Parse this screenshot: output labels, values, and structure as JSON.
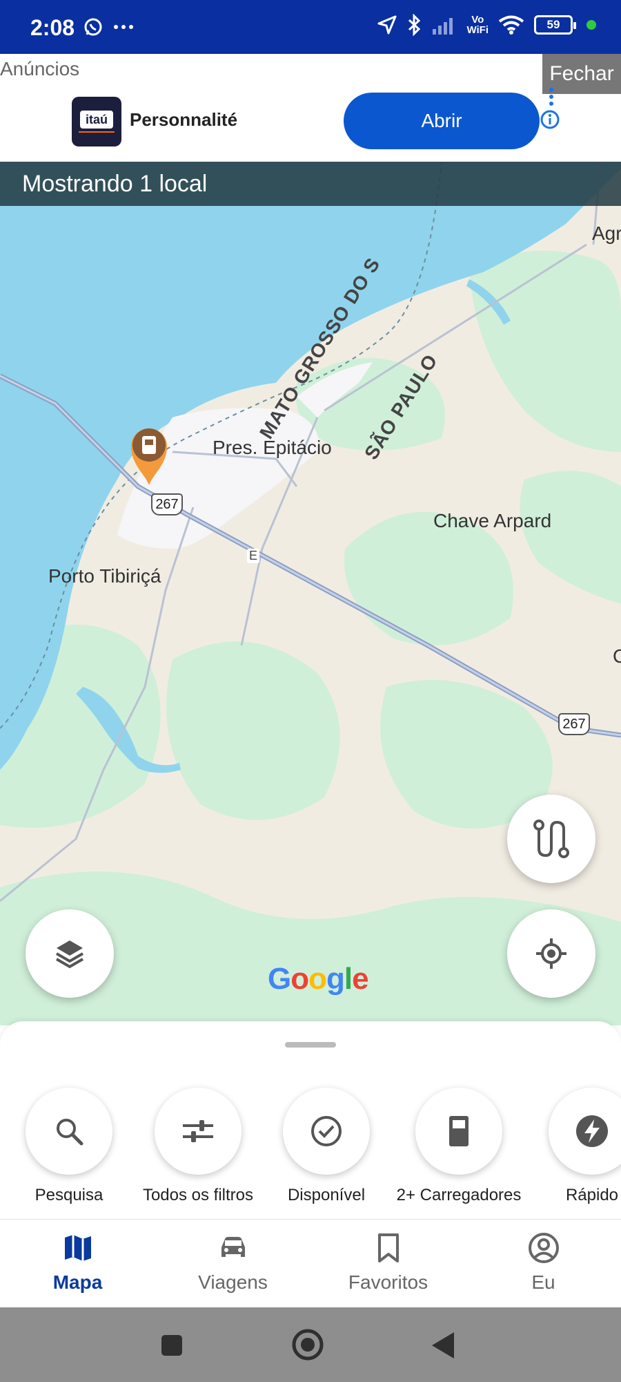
{
  "status_bar": {
    "time": "2:08",
    "vowifi_top": "Vo",
    "vowifi_bottom": "WiFi",
    "battery": "59"
  },
  "ad": {
    "label": "Anúncios",
    "close": "Fechar",
    "logo_text": "itaú",
    "brand": "Personnalité",
    "cta": "Abrir"
  },
  "map": {
    "showing": "Mostrando 1 local",
    "labels": {
      "mato_grosso": "MATO GROSSO DO S",
      "sao_paulo": "SÃO PAULO",
      "agr": "Agr",
      "pres_epitacio": "Pres. Epitácio",
      "chave_arpard": "Chave Arpard",
      "porto_tibirica": "Porto Tibiriçá",
      "edge_c": "C"
    },
    "road_shields": [
      "267",
      "267"
    ],
    "road_e": "E",
    "google": [
      "G",
      "o",
      "o",
      "g",
      "l",
      "e"
    ]
  },
  "filters": [
    {
      "label": "Pesquisa",
      "icon": "search-icon"
    },
    {
      "label": "Todos os filtros",
      "icon": "sliders-icon"
    },
    {
      "label": "Disponível",
      "icon": "check-circle-icon"
    },
    {
      "label": "2+ Carregadores",
      "icon": "fuel-pump-icon"
    },
    {
      "label": "Rápido",
      "icon": "bolt-icon"
    }
  ],
  "nav": [
    {
      "label": "Mapa",
      "icon": "map-icon",
      "active": true
    },
    {
      "label": "Viagens",
      "icon": "car-icon",
      "active": false
    },
    {
      "label": "Favoritos",
      "icon": "bookmark-icon",
      "active": false
    },
    {
      "label": "Eu",
      "icon": "account-icon",
      "active": false
    }
  ],
  "colors": {
    "status_bar": "#0a2fa0",
    "accent": "#0a3a9e",
    "ad_button": "#0b57d0",
    "water": "#8fd4ec",
    "green_land": "#d0efd9",
    "pin": "#f39a3c"
  }
}
